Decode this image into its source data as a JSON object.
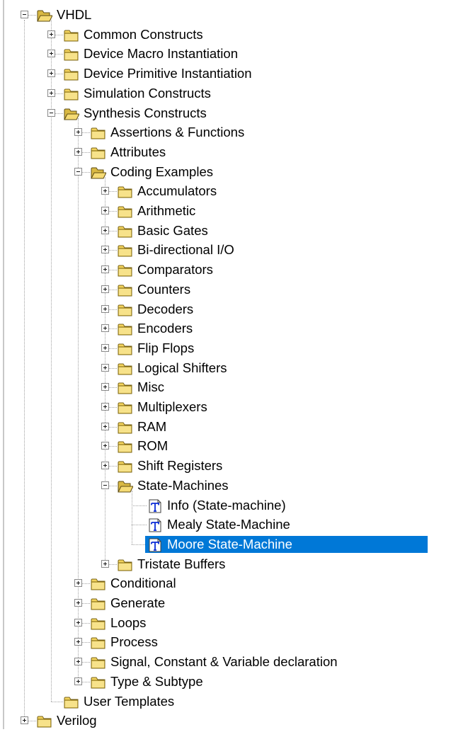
{
  "tree": [
    {
      "label": "VHDL",
      "level": 0,
      "type": "folder",
      "expanded": true
    },
    {
      "label": "Common Constructs",
      "level": 1,
      "type": "folder",
      "expanded": false
    },
    {
      "label": "Device Macro Instantiation",
      "level": 1,
      "type": "folder",
      "expanded": false
    },
    {
      "label": "Device Primitive Instantiation",
      "level": 1,
      "type": "folder",
      "expanded": false
    },
    {
      "label": "Simulation Constructs",
      "level": 1,
      "type": "folder",
      "expanded": false
    },
    {
      "label": "Synthesis Constructs",
      "level": 1,
      "type": "folder",
      "expanded": true
    },
    {
      "label": "Assertions & Functions",
      "level": 2,
      "type": "folder",
      "expanded": false
    },
    {
      "label": "Attributes",
      "level": 2,
      "type": "folder",
      "expanded": false
    },
    {
      "label": "Coding Examples",
      "level": 2,
      "type": "folder",
      "expanded": true
    },
    {
      "label": "Accumulators",
      "level": 3,
      "type": "folder",
      "expanded": false
    },
    {
      "label": "Arithmetic",
      "level": 3,
      "type": "folder",
      "expanded": false
    },
    {
      "label": "Basic Gates",
      "level": 3,
      "type": "folder",
      "expanded": false
    },
    {
      "label": "Bi-directional I/O",
      "level": 3,
      "type": "folder",
      "expanded": false
    },
    {
      "label": "Comparators",
      "level": 3,
      "type": "folder",
      "expanded": false
    },
    {
      "label": "Counters",
      "level": 3,
      "type": "folder",
      "expanded": false
    },
    {
      "label": "Decoders",
      "level": 3,
      "type": "folder",
      "expanded": false
    },
    {
      "label": "Encoders",
      "level": 3,
      "type": "folder",
      "expanded": false
    },
    {
      "label": "Flip Flops",
      "level": 3,
      "type": "folder",
      "expanded": false
    },
    {
      "label": "Logical Shifters",
      "level": 3,
      "type": "folder",
      "expanded": false
    },
    {
      "label": "Misc",
      "level": 3,
      "type": "folder",
      "expanded": false
    },
    {
      "label": "Multiplexers",
      "level": 3,
      "type": "folder",
      "expanded": false
    },
    {
      "label": "RAM",
      "level": 3,
      "type": "folder",
      "expanded": false
    },
    {
      "label": "ROM",
      "level": 3,
      "type": "folder",
      "expanded": false
    },
    {
      "label": "Shift Registers",
      "level": 3,
      "type": "folder",
      "expanded": false
    },
    {
      "label": "State-Machines",
      "level": 3,
      "type": "folder",
      "expanded": true
    },
    {
      "label": "Info (State-machine)",
      "level": 4,
      "type": "template"
    },
    {
      "label": "Mealy State-Machine",
      "level": 4,
      "type": "template"
    },
    {
      "label": "Moore State-Machine",
      "level": 4,
      "type": "template",
      "selected": true
    },
    {
      "label": "Tristate Buffers",
      "level": 3,
      "type": "folder",
      "expanded": false
    },
    {
      "label": "Conditional",
      "level": 2,
      "type": "folder",
      "expanded": false
    },
    {
      "label": "Generate",
      "level": 2,
      "type": "folder",
      "expanded": false
    },
    {
      "label": "Loops",
      "level": 2,
      "type": "folder",
      "expanded": false
    },
    {
      "label": "Process",
      "level": 2,
      "type": "folder",
      "expanded": false
    },
    {
      "label": "Signal, Constant & Variable declaration",
      "level": 2,
      "type": "folder",
      "expanded": false
    },
    {
      "label": "Type & Subtype",
      "level": 2,
      "type": "folder",
      "expanded": false
    },
    {
      "label": "User Templates",
      "level": 1,
      "type": "folder",
      "leaf": true
    },
    {
      "label": "Verilog",
      "level": 0,
      "type": "folder",
      "expanded": false
    }
  ],
  "icons": {
    "folder_closed": "folder-closed-icon",
    "folder_open": "folder-open-icon",
    "template": "template-text-icon"
  },
  "colors": {
    "selection": "#0078d7",
    "folder_fill": "#f3d35c",
    "template_letter": "#0a2bd6"
  }
}
